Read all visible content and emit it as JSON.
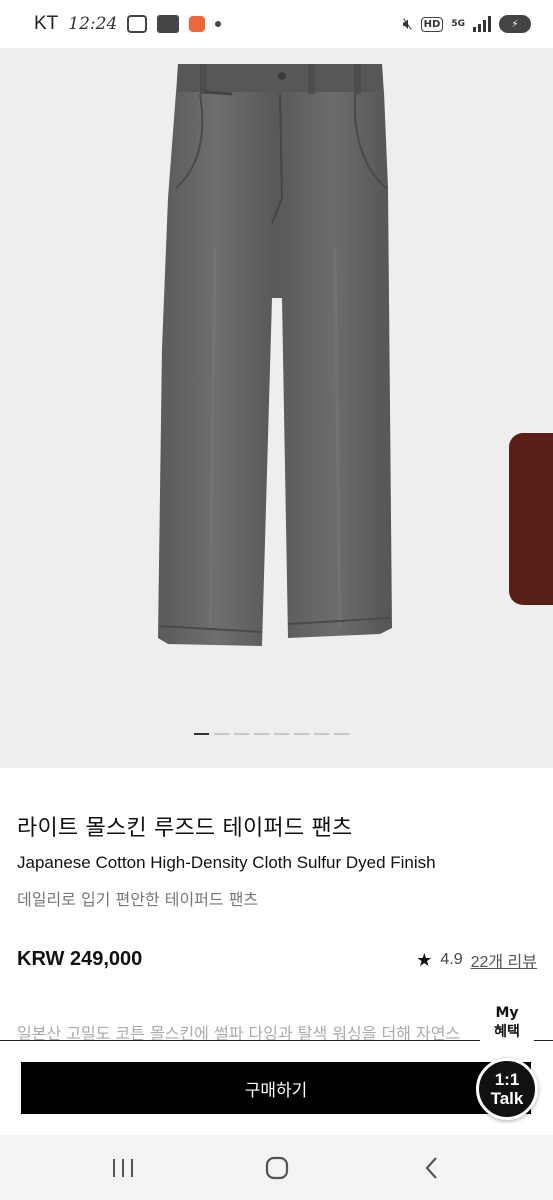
{
  "status_bar": {
    "carrier": "KT",
    "time": "12:24",
    "hd": "HD",
    "network": "5G"
  },
  "icons": {
    "gallery": "gallery-icon",
    "webtoon": "webtoon-icon",
    "app": "app-notification-icon",
    "mute": "mute-icon",
    "signal": "signal-icon",
    "battery": "battery-icon",
    "star": "star-icon",
    "recent": "recent-apps-icon",
    "home": "home-icon",
    "back": "back-icon"
  },
  "product": {
    "title_ko": "라이트 몰스킨 루즈드 테이퍼드 팬츠",
    "title_en": "Japanese Cotton High-Density Cloth Sulfur Dyed Finish",
    "subtitle": "데일리로 입기 편안한 테이퍼드 팬츠",
    "price": "KRW 249,000",
    "rating": "4.9",
    "reviews": "22개 리뷰",
    "description": "일본산 고밀도 코튼 몰스킨에 썰파 다잉과 탈색 워싱을 더해 자연스"
  },
  "carousel": {
    "total": 8,
    "active_index": 0
  },
  "floating": {
    "my_benefit_line1": "My",
    "my_benefit_line2": "혜택",
    "talk_line1": "1:1",
    "talk_line2": "Talk"
  },
  "actions": {
    "buy_label": "구매하기"
  },
  "colors": {
    "hero_background": "#eeeeee",
    "side_tab": "#5a1f16",
    "pants": "#5f5f5f",
    "buy_button": "#000000"
  }
}
